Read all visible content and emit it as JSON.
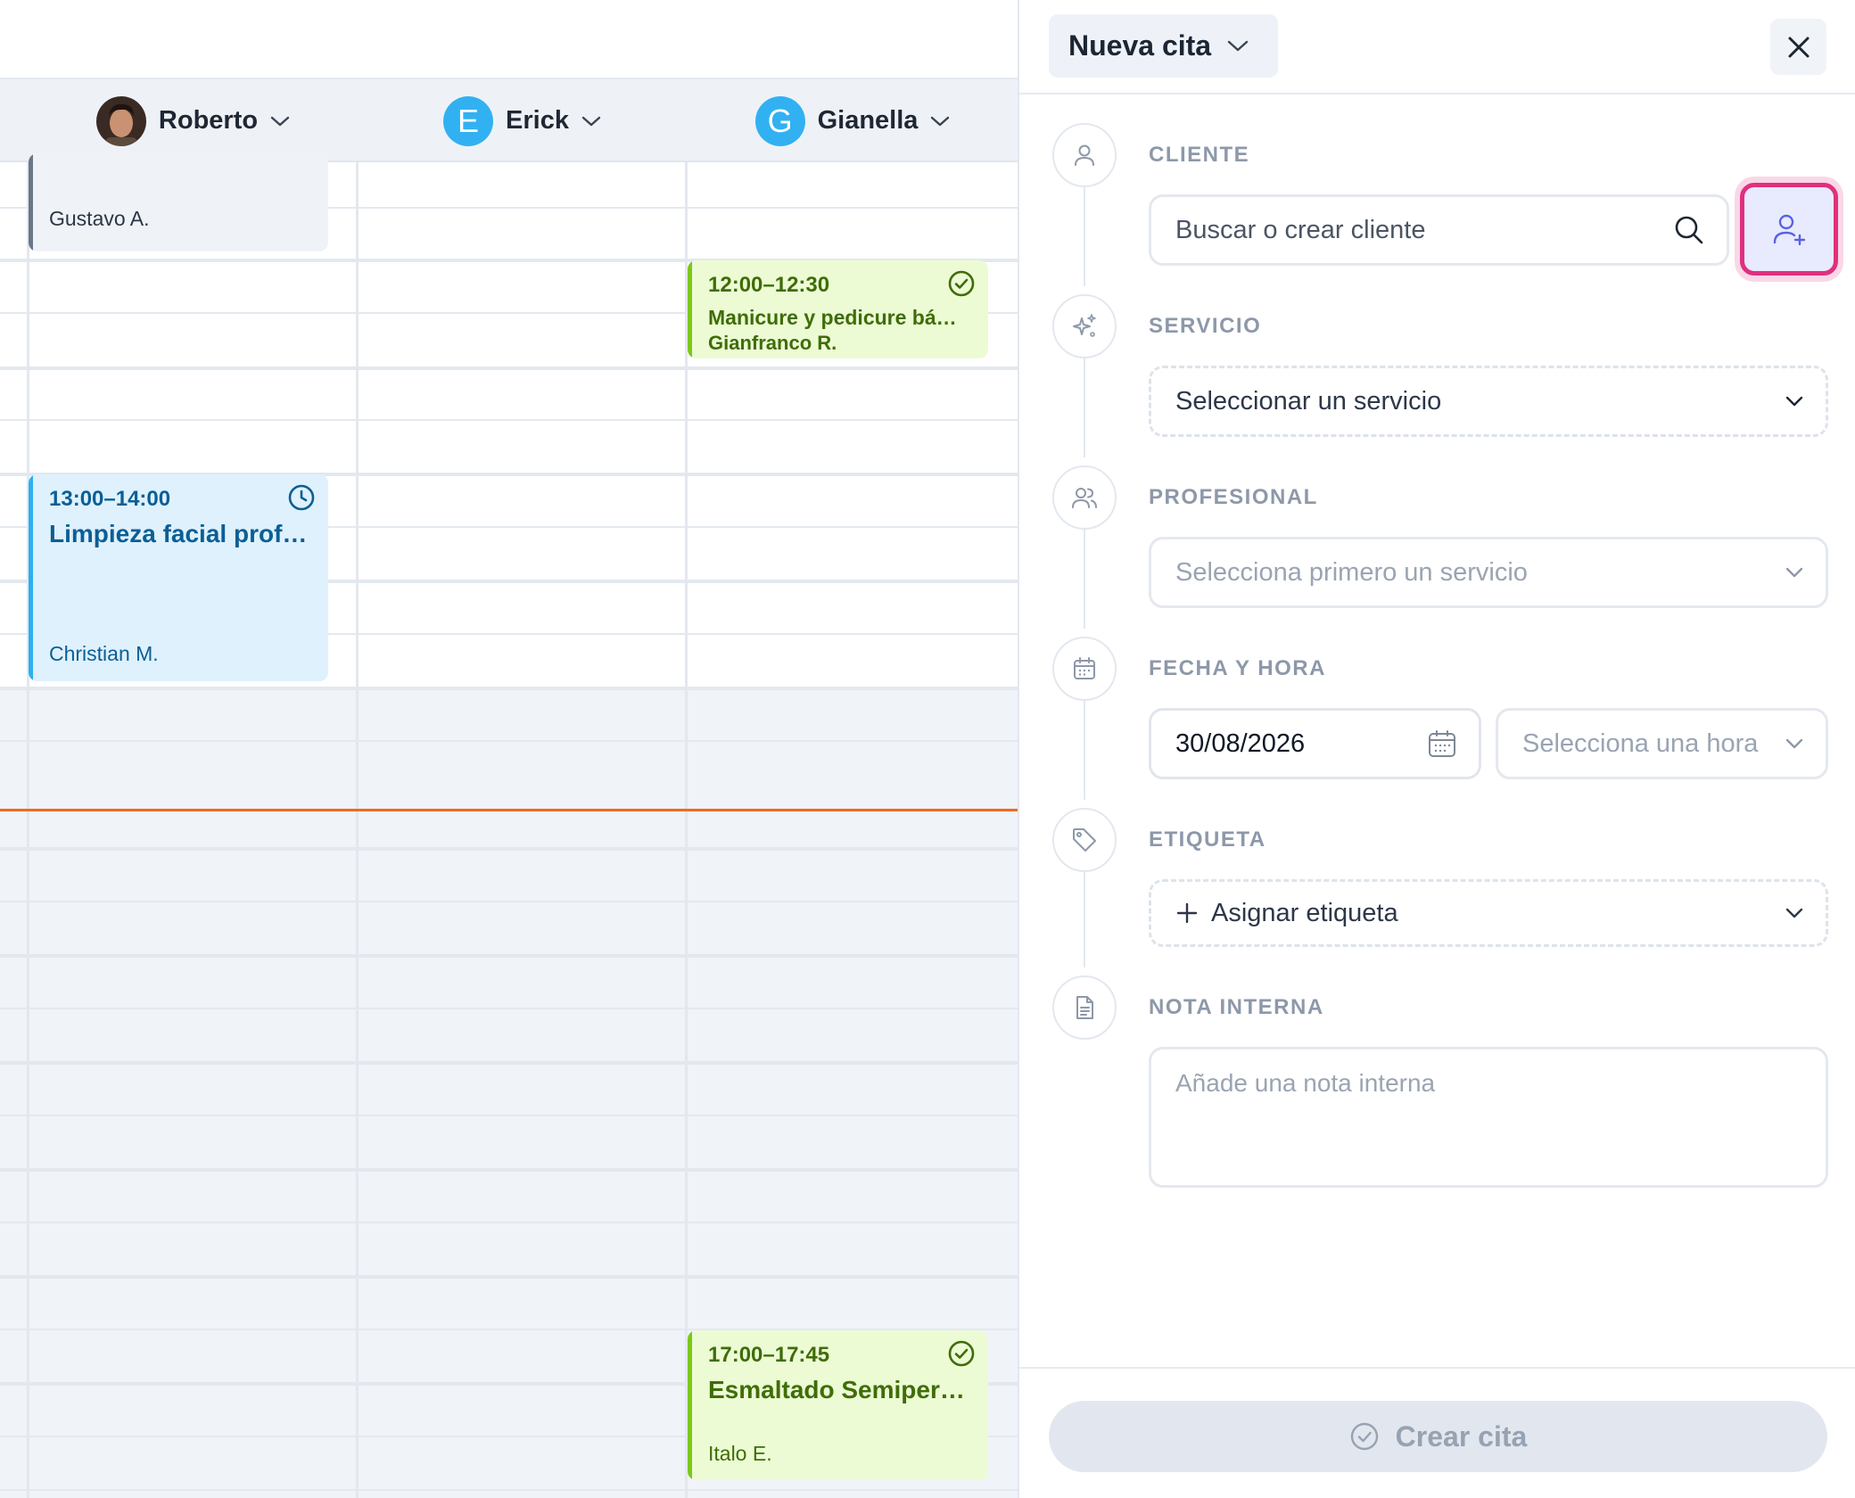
{
  "calendar": {
    "staff": [
      {
        "name": "Roberto",
        "avatar": "photo"
      },
      {
        "name": "Erick",
        "avatar_letter": "E"
      },
      {
        "name": "Gianella",
        "avatar_letter": "G"
      }
    ],
    "events": [
      {
        "client": "Gustavo A.",
        "color": "#6a7787"
      },
      {
        "time": "12:00–12:30",
        "title": "Manicure y pedicure bá…",
        "client": "Gianfranco R.",
        "status_icon": "check-circle-icon",
        "color": "#7cc81a"
      },
      {
        "time": "13:00–14:00",
        "title": "Limpieza facial prof…",
        "client": "Christian M.",
        "status_icon": "clock-icon",
        "color": "#2bb0f0"
      },
      {
        "time": "17:00–17:45",
        "title": "Esmaltado Semiper…",
        "client": "Italo E.",
        "status_icon": "check-circle-icon",
        "color": "#7cc81a"
      }
    ],
    "current_time_line_color": "#ef6a23"
  },
  "panel": {
    "type_select": {
      "label": "Nueva cita"
    },
    "client": {
      "label": "CLIENTE",
      "placeholder": "Buscar o crear cliente"
    },
    "service": {
      "label": "SERVICIO",
      "placeholder": "Seleccionar un servicio"
    },
    "professional": {
      "label": "PROFESIONAL",
      "placeholder": "Selecciona primero un servicio"
    },
    "datetime": {
      "label": "FECHA Y HORA",
      "date_value": "30/08/2026",
      "time_placeholder": "Selecciona una hora"
    },
    "tag": {
      "label": "ETIQUETA",
      "button_label": "Asignar etiqueta"
    },
    "note": {
      "label": "NOTA INTERNA",
      "placeholder": "Añade una nota interna"
    },
    "submit": {
      "label": "Crear cita"
    },
    "accent_color": "#e0307f"
  }
}
